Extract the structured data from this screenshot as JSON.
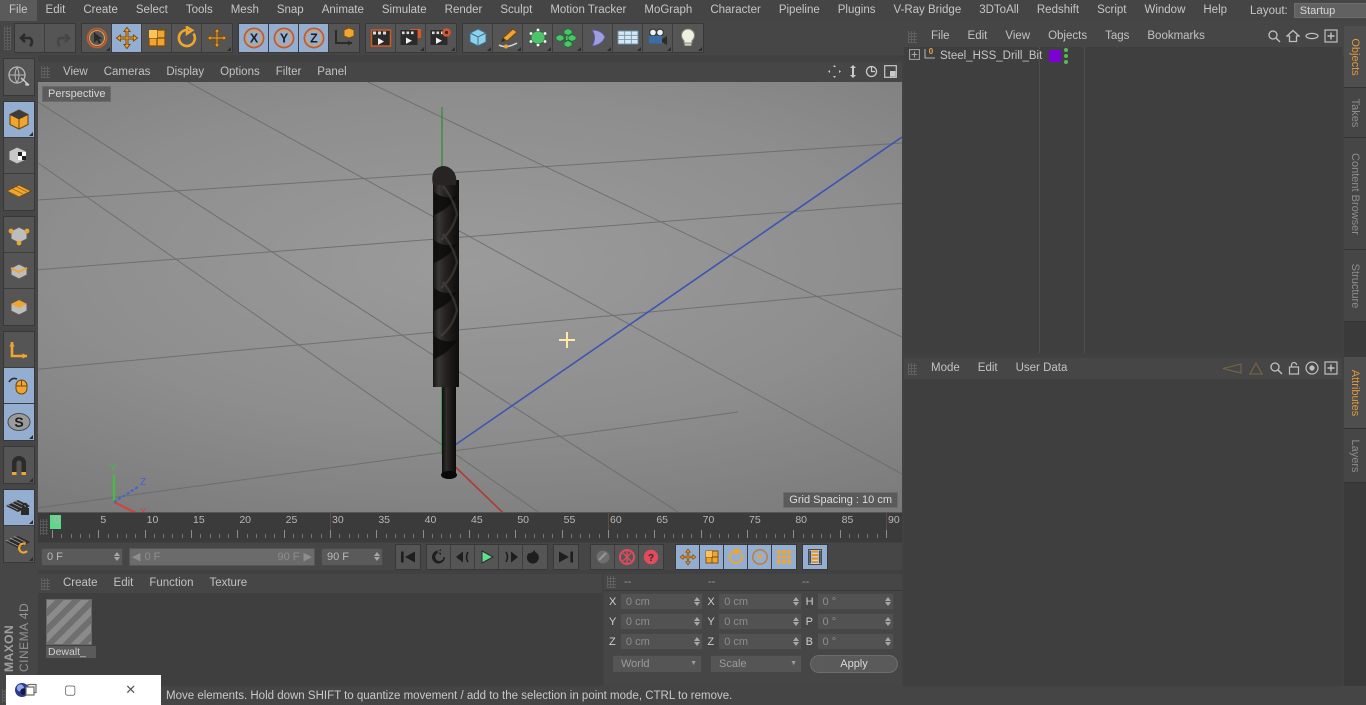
{
  "app": {
    "name": "CINEMA 4D",
    "vendor": "MAXON"
  },
  "menubar": {
    "items": [
      "File",
      "Edit",
      "Create",
      "Select",
      "Tools",
      "Mesh",
      "Snap",
      "Animate",
      "Simulate",
      "Render",
      "Sculpt",
      "Motion Tracker",
      "MoGraph",
      "Character",
      "Pipeline",
      "Plugins",
      "V-Ray Bridge",
      "3DToAll",
      "Redshift",
      "Script",
      "Window",
      "Help"
    ],
    "layout_label": "Layout:",
    "layout_value": "Startup",
    "search_icon": "search-icon"
  },
  "toolbar": {
    "groups": [
      {
        "name": "history",
        "buttons": [
          {
            "icon": "undo-icon",
            "active": false
          },
          {
            "icon": "redo-icon",
            "active": false
          }
        ]
      },
      {
        "name": "transform",
        "buttons": [
          {
            "icon": "live-selection-icon",
            "active": false
          },
          {
            "icon": "move-icon",
            "active": true
          },
          {
            "icon": "scale-icon",
            "active": false
          },
          {
            "icon": "rotate-icon",
            "active": false
          },
          {
            "icon": "move-dup-icon",
            "active": false
          }
        ]
      },
      {
        "name": "axis-lock",
        "buttons": [
          {
            "icon": "x-axis-icon",
            "active": true
          },
          {
            "icon": "y-axis-icon",
            "active": true
          },
          {
            "icon": "z-axis-icon",
            "active": true
          },
          {
            "icon": "world-object-coords-icon",
            "active": false
          }
        ]
      },
      {
        "name": "render",
        "buttons": [
          {
            "icon": "render-view-icon",
            "active": false
          },
          {
            "icon": "render-to-picture-viewer-icon",
            "active": false
          },
          {
            "icon": "render-settings-icon",
            "active": false
          }
        ]
      },
      {
        "name": "objects",
        "buttons": [
          {
            "icon": "cube-primitive-icon",
            "active": false
          },
          {
            "icon": "spline-pen-icon",
            "active": false
          },
          {
            "icon": "nurbs-generator-icon",
            "active": false
          },
          {
            "icon": "array-icon",
            "active": false
          },
          {
            "icon": "bend-deformer-icon",
            "active": false
          },
          {
            "icon": "floor-environment-icon",
            "active": false
          },
          {
            "icon": "camera-icon",
            "active": false
          },
          {
            "icon": "light-icon",
            "active": false
          }
        ]
      }
    ]
  },
  "left_toolbar": {
    "groups": [
      {
        "buttons": [
          {
            "icon": "make-editable-icon",
            "active": false
          }
        ]
      },
      {
        "buttons": [
          {
            "icon": "model-mode-icon",
            "active": true
          },
          {
            "icon": "texture-mode-icon",
            "active": false
          },
          {
            "icon": "workplane-mode-icon",
            "active": false
          }
        ]
      },
      {
        "buttons": [
          {
            "icon": "point-mode-icon",
            "active": false
          },
          {
            "icon": "edge-mode-icon",
            "active": false
          },
          {
            "icon": "polygon-mode-icon",
            "active": false
          }
        ]
      },
      {
        "buttons": [
          {
            "icon": "object-axis-mode-icon",
            "active": false
          },
          {
            "icon": "viewport-solo-mouse-icon",
            "active": true
          },
          {
            "icon": "enable-axis-modification-icon",
            "active": true
          }
        ]
      },
      {
        "buttons": [
          {
            "icon": "magnet-snap-icon",
            "active": false
          }
        ]
      },
      {
        "buttons": [
          {
            "icon": "workplane-lock-icon",
            "active": true
          },
          {
            "icon": "workplane-rotate-icon",
            "active": false
          }
        ]
      }
    ]
  },
  "viewport": {
    "menu": [
      "View",
      "Cameras",
      "Display",
      "Options",
      "Filter",
      "Panel"
    ],
    "corner_icons": [
      "pan-view-icon",
      "dolly-view-icon",
      "rotate-view-icon",
      "maximize-view-icon"
    ],
    "label": "Perspective",
    "grid_spacing": "Grid Spacing : 10 cm",
    "axis_gizmo": {
      "x": "X",
      "y": "Y",
      "z": "Z",
      "x_color": "#d44040",
      "y_color": "#3fc03f",
      "z_color": "#4060d8"
    },
    "cursor": "move-crosshair-cursor",
    "model": {
      "name": "Steel HSS Drill Bit",
      "color": "#231f1e"
    }
  },
  "timeline": {
    "ticks": [
      "0",
      "5",
      "10",
      "15",
      "20",
      "25",
      "30",
      "35",
      "40",
      "45",
      "50",
      "55",
      "60",
      "65",
      "70",
      "75",
      "80",
      "85",
      "90"
    ],
    "current_frame_marker": 0,
    "end_field": "0 F"
  },
  "transport": {
    "current_frame": "0 F",
    "range_start": "0 F",
    "range_end": "90 F",
    "max_frame": "90 F",
    "buttons": [
      {
        "icon": "go-to-start-icon",
        "active": false
      },
      {
        "icon": "play-reverse-loop-icon",
        "active": false
      },
      {
        "icon": "step-back-icon",
        "active": false
      },
      {
        "icon": "play-forward-icon",
        "active": false
      },
      {
        "icon": "step-forward-icon",
        "active": false
      },
      {
        "icon": "loop-playback-icon",
        "active": false
      },
      {
        "icon": "go-to-end-icon",
        "active": false
      },
      {
        "icon": "record-active-objects-icon",
        "active": false
      },
      {
        "icon": "autokeying-icon",
        "active": false
      },
      {
        "icon": "keyframe-selection-icon",
        "active": false
      },
      {
        "icon": "position-key-icon",
        "active": true
      },
      {
        "icon": "scale-key-icon",
        "active": true
      },
      {
        "icon": "rotation-key-icon",
        "active": true
      },
      {
        "icon": "parameter-key-icon",
        "active": true
      },
      {
        "icon": "point-level-animation-icon",
        "active": true
      },
      {
        "icon": "timeline-window-icon",
        "active": true
      }
    ]
  },
  "material_manager": {
    "menu": [
      "Create",
      "Edit",
      "Function",
      "Texture"
    ],
    "materials": [
      {
        "name": "Dewalt_"
      }
    ]
  },
  "coordinate_manager": {
    "headers": [
      "--",
      "--",
      "--"
    ],
    "rows": [
      {
        "pos_label": "X",
        "pos_value": "0 cm",
        "size_label": "X",
        "size_value": "0 cm",
        "rot_label": "H",
        "rot_value": "0 °"
      },
      {
        "pos_label": "Y",
        "pos_value": "0 cm",
        "size_label": "Y",
        "size_value": "0 cm",
        "rot_label": "P",
        "rot_value": "0 °"
      },
      {
        "pos_label": "Z",
        "pos_value": "0 cm",
        "size_label": "Z",
        "size_value": "0 cm",
        "rot_label": "B",
        "rot_value": "0 °"
      }
    ],
    "coord_system": "World",
    "size_mode": "Scale",
    "apply_label": "Apply"
  },
  "object_manager": {
    "menu": [
      "File",
      "Edit",
      "View",
      "Objects",
      "Tags",
      "Bookmarks"
    ],
    "icons": [
      "search-icon",
      "home-icon",
      "eye-icon",
      "add-layer-icon"
    ],
    "objects": [
      {
        "name": "Steel_HSS_Drill_Bit",
        "level_badge": "0",
        "swatch_color": "#7c00d4",
        "dots": "green"
      }
    ]
  },
  "attribute_manager": {
    "menu": [
      "Mode",
      "Edit",
      "User Data"
    ],
    "icons": [
      "left-nav-icon",
      "right-nav-icon",
      "search-icon",
      "lock-icon",
      "target-icon",
      "add-tab-icon"
    ]
  },
  "right_tabs": {
    "top": [
      {
        "label": "Objects",
        "selected": true
      },
      {
        "label": "Takes",
        "selected": false
      },
      {
        "label": "Content Browser",
        "selected": false
      },
      {
        "label": "Structure",
        "selected": false
      }
    ],
    "bottom": [
      {
        "label": "Attributes",
        "selected": true
      },
      {
        "label": "Layers",
        "selected": false
      }
    ]
  },
  "statusbar": {
    "text": "Move elements. Hold down SHIFT to quantize movement / add to the selection in point mode, CTRL to remove."
  },
  "window_chrome": {
    "minimize": "—",
    "maximize": "▢",
    "close": "✕",
    "app_icon": "cinema4d-app-icon"
  }
}
